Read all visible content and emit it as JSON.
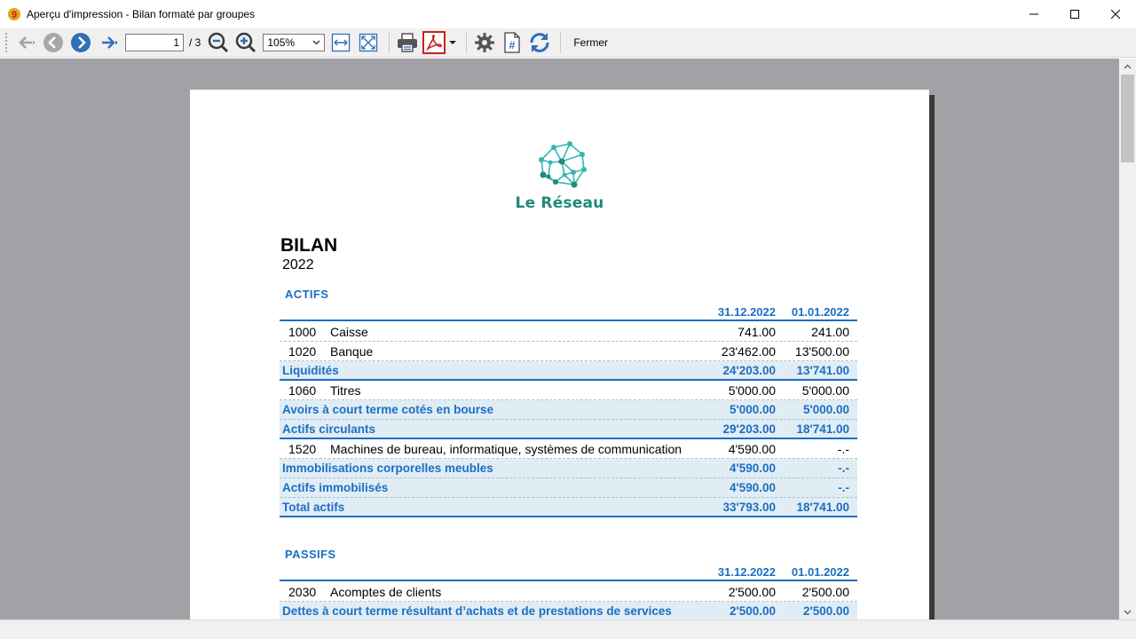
{
  "window": {
    "title": "Aperçu d'impression - Bilan formaté par groupes"
  },
  "toolbar": {
    "page_current": "1",
    "page_total": "/ 3",
    "zoom": "105%",
    "close_label": "Fermer"
  },
  "report": {
    "logo_text": "Le Réseau",
    "title": "BILAN",
    "year": "2022",
    "assets": {
      "label": "ACTIFS",
      "col1": "31.12.2022",
      "col2": "01.01.2022",
      "rows": [
        {
          "type": "account",
          "acc": "1000",
          "desc": "Caisse",
          "v1": "741.00",
          "v2": "241.00"
        },
        {
          "type": "account",
          "acc": "1020",
          "desc": "Banque",
          "v1": "23'462.00",
          "v2": "13'500.00"
        },
        {
          "type": "group",
          "acc": "",
          "desc": "Liquidités",
          "v1": "24'203.00",
          "v2": "13'741.00"
        },
        {
          "type": "account",
          "acc": "1060",
          "desc": "Titres",
          "v1": "5'000.00",
          "v2": "5'000.00"
        },
        {
          "type": "group",
          "acc": "",
          "desc": "Avoirs à court terme cotés en bourse",
          "v1": "5'000.00",
          "v2": "5'000.00"
        },
        {
          "type": "group",
          "acc": "",
          "desc": "Actifs circulants",
          "v1": "29'203.00",
          "v2": "18'741.00"
        },
        {
          "type": "account",
          "acc": "1520",
          "desc": "Machines de bureau, informatique, systèmes de communication",
          "v1": "4'590.00",
          "v2": "-.-"
        },
        {
          "type": "group",
          "acc": "",
          "desc": "Immobilisations corporelles meubles",
          "v1": "4'590.00",
          "v2": "-.-"
        },
        {
          "type": "group",
          "acc": "",
          "desc": "Actifs immobilisés",
          "v1": "4'590.00",
          "v2": "-.-"
        },
        {
          "type": "group",
          "acc": "",
          "desc": "Total actifs",
          "v1": "33'793.00",
          "v2": "18'741.00"
        }
      ]
    },
    "liabilities": {
      "label": "PASSIFS",
      "col1": "31.12.2022",
      "col2": "01.01.2022",
      "rows": [
        {
          "type": "account",
          "acc": "2030",
          "desc": "Acomptes de clients",
          "v1": "2'500.00",
          "v2": "2'500.00"
        },
        {
          "type": "group",
          "acc": "",
          "desc": "Dettes à court terme résultant d’achats et de prestations de services",
          "v1": "2'500.00",
          "v2": "2'500.00"
        }
      ]
    }
  },
  "colors": {
    "accent": "#1b6fc2",
    "group_bg": "#e1edf5",
    "logo": "#1e8a7a",
    "preview_bg": "#a2a2a6"
  }
}
